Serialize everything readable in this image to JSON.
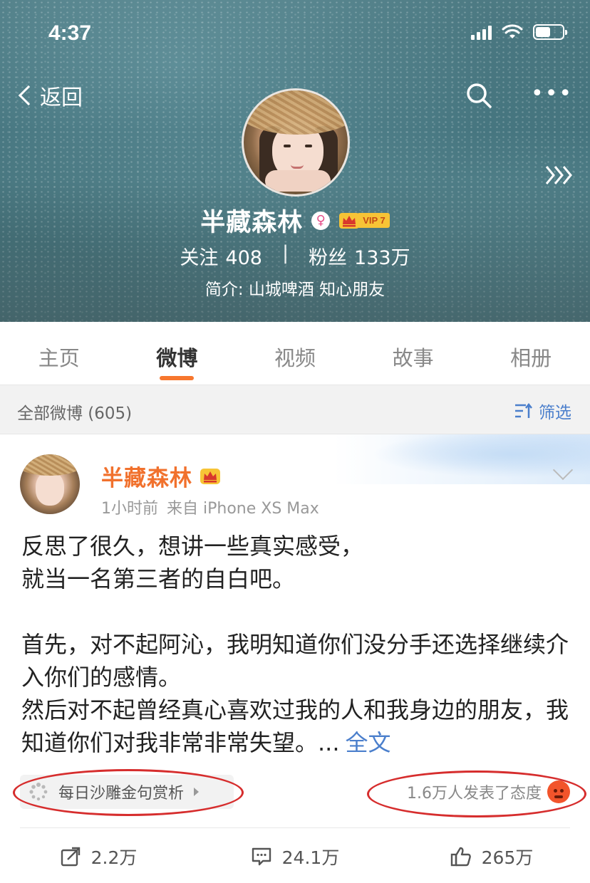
{
  "status_bar": {
    "time": "4:37",
    "battery_level": 0.55
  },
  "nav": {
    "back_label": "返回"
  },
  "profile": {
    "name": "半藏森林",
    "gender_symbol": "♀",
    "vip_label": "VIP 7",
    "following_label": "关注",
    "following_count": "408",
    "followers_label": "粉丝",
    "followers_count": "133万",
    "separator": "|",
    "bio": "简介: 山城啤酒 知心朋友"
  },
  "tabs": [
    {
      "label": "主页",
      "active": false
    },
    {
      "label": "微博",
      "active": true
    },
    {
      "label": "视频",
      "active": false
    },
    {
      "label": "故事",
      "active": false
    },
    {
      "label": "相册",
      "active": false
    }
  ],
  "filter": {
    "count_label": "全部微博 (605)",
    "button_label": "筛选"
  },
  "post": {
    "author": "半藏森林",
    "time": "1小时前",
    "source": "来自 iPhone XS Max",
    "lines": [
      "反思了很久，想讲一些真实感受，",
      "就当一名第三者的自白吧。",
      "",
      "首先，对不起阿沁，我明知道你们没分手还选择继续介入你们的感情。",
      "然后对不起曾经真心喜欢过我的人和我身边的朋友，我知道你们对我非常非常失望。..."
    ],
    "more_label": "全文",
    "tag_label": "每日沙雕金句赏析",
    "reaction_text": "1.6万人发表了态度",
    "repost_count": "2.2万",
    "comment_count": "24.1万",
    "like_count": "265万"
  },
  "colors": {
    "accent": "#f7772e",
    "link": "#4b7fcc",
    "name_orange": "#f1712d",
    "annotation_red": "#d62d2d"
  }
}
